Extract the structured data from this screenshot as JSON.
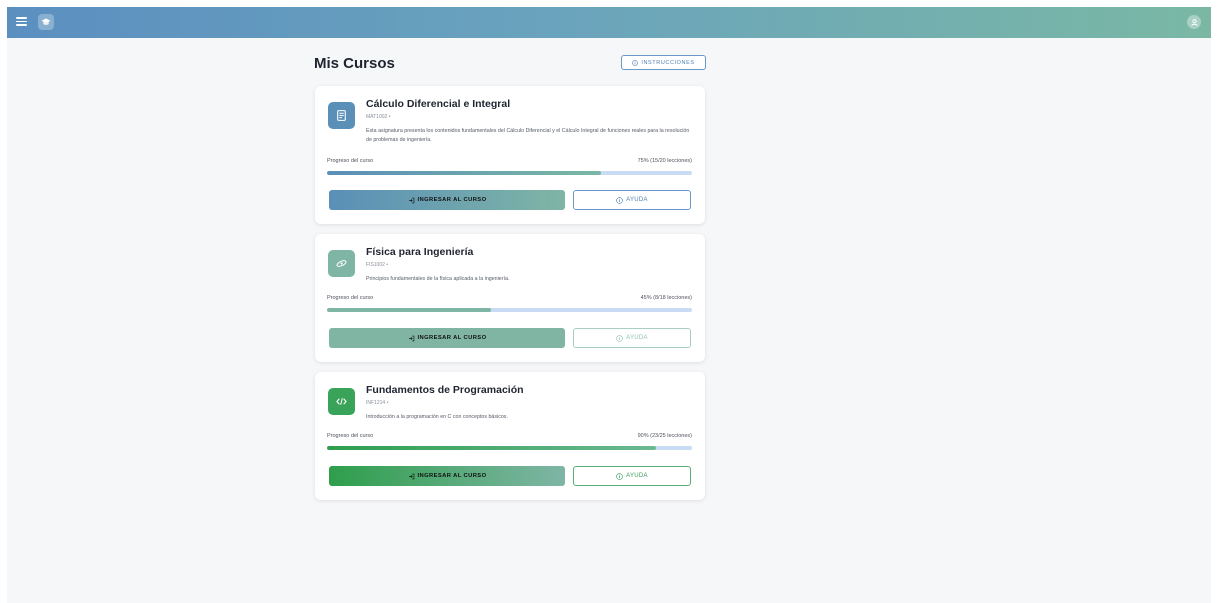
{
  "header": {
    "menu_icon": "hamburger-menu-icon",
    "logo_icon": "graduation-cap-icon",
    "avatar_icon": "user-avatar-icon",
    "colors": {
      "gradient_start": "#5b8fc0",
      "gradient_end": "#7ab8a4"
    }
  },
  "main": {
    "title": "Mis Cursos",
    "instructions_label": "INSTRUCCIONES",
    "instructions_icon": "info-icon"
  },
  "courses": [
    {
      "title": "Cálculo Diferencial e Integral",
      "code": "MAT1002 •",
      "description": "Esta asignatura presenta los contenidos fundamentales del Cálculo Diferencial y el Cálculo Integral de funciones reales para la resolución de problemas de ingeniería.",
      "progress_label": "Progreso del curso",
      "progress_text": "75% (15/20 lecciones)",
      "progress_fraction": 0.75,
      "enter_label": "INGRESAR AL CURSO",
      "help_label": "AYUDA",
      "icon": "document-icon",
      "accent": "#5a8fb8"
    },
    {
      "title": "Física para Ingeniería",
      "code": "FIS1002 •",
      "description": "Principios fundamentales de la física aplicada a la ingeniería.",
      "progress_label": "Progreso del curso",
      "progress_text": "45% (8/18 lecciones)",
      "progress_fraction": 0.45,
      "enter_label": "INGRESAR AL CURSO",
      "help_label": "AYUDA",
      "icon": "atom-icon",
      "accent": "#7fb5a5"
    },
    {
      "title": "Fundamentos de Programación",
      "code": "INF1214 •",
      "description": "Introducción a la programación en C con conceptos básicos.",
      "progress_label": "Progreso del curso",
      "progress_text": "90% (23/25 lecciones)",
      "progress_fraction": 0.9,
      "enter_label": "INGRESAR AL CURSO",
      "help_label": "AYUDA",
      "icon": "code-icon",
      "accent": "#3aa35a"
    }
  ]
}
